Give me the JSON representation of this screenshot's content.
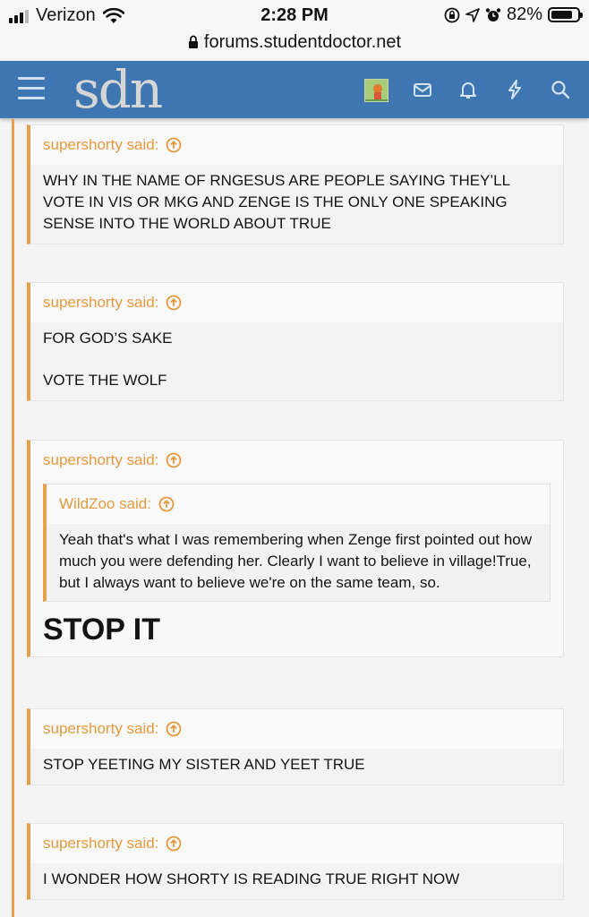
{
  "status_bar": {
    "carrier": "Verizon",
    "time": "2:28 PM",
    "battery": "82%",
    "battery_level": 0.82,
    "url": "forums.studentdoctor.net"
  },
  "header": {
    "logo": "sdn",
    "brand_color": "#3d76b0",
    "accent_color": "#e5a14b",
    "icons": [
      "menu-icon",
      "avatar",
      "mail-icon",
      "bell-icon",
      "bolt-icon",
      "search-icon"
    ]
  },
  "quotes": [
    {
      "author": "supershorty said:",
      "paragraphs": [
        "WHY IN THE NAME OF RNGESUS ARE PEOPLE SAYING THEY’LL VOTE IN VIS OR MKG AND ZENGE IS THE ONLY ONE SPEAKING SENSE INTO THE WORLD ABOUT TRUE"
      ]
    },
    {
      "author": "supershorty said:",
      "paragraphs": [
        "FOR GOD’S SAKE",
        "VOTE THE WOLF"
      ]
    },
    {
      "author": "supershorty said:",
      "nested": {
        "author": "WildZoo said:",
        "text": "Yeah that's what I was remembering when Zenge first pointed out how much you were defending her. Clearly I want to believe in village!True, but I always want to believe we're on the same team, so."
      },
      "big_text": "STOP IT"
    },
    {
      "author": "supershorty said:",
      "paragraphs": [
        "STOP YEETING MY SISTER AND YEET TRUE"
      ]
    },
    {
      "author": "supershorty said:",
      "paragraphs": [
        "I WONDER HOW SHORTY IS READING TRUE RIGHT NOW"
      ]
    }
  ]
}
